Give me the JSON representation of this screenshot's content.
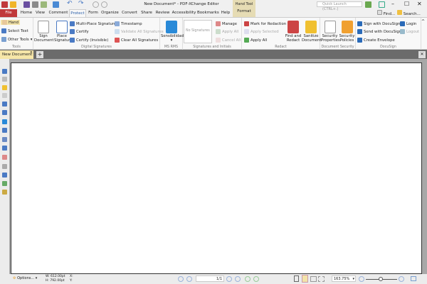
{
  "window": {
    "title": "New Document* - PDF-XChange Editor",
    "quick_launch_placeholder": "Quick Launch (CTRL+.)",
    "find": "Find...",
    "search": "Search..."
  },
  "context_tab": {
    "label": "Hand Tool",
    "sub": "Format"
  },
  "tabs": [
    "File",
    "Home",
    "View",
    "Comment",
    "Protect",
    "Form",
    "Organize",
    "Convert",
    "Share",
    "Review",
    "Accessibility",
    "Bookmarks",
    "Help"
  ],
  "active_tab": "Protect",
  "ribbon": {
    "tools": {
      "label": "Tools",
      "items": [
        "Hand",
        "Select Text",
        "Other Tools"
      ]
    },
    "digital_signatures": {
      "label": "Digital Signatures",
      "big": [
        "Sign Document",
        "Place Signature"
      ],
      "items": [
        "Multi-Place Signature",
        "Certify",
        "Certify (Invisible)",
        "Timestamp",
        "Validate All Signatures",
        "Clear All Signatures"
      ]
    },
    "ms_rms": {
      "label": "MS RMS",
      "big": "Sensibilidad"
    },
    "signatures_initials": {
      "label": "Signatures and Initials",
      "dropdown": "No Signatures",
      "items": [
        "Manage",
        "Apply All",
        "Cancel All"
      ]
    },
    "redact": {
      "label": "Redact",
      "items": [
        "Mark for Redaction",
        "Apply Selected",
        "Apply All"
      ],
      "big": [
        "Find and Redact",
        "Sanitize Document"
      ]
    },
    "document_security": {
      "label": "Document Security",
      "big": [
        "Security Properties",
        "Security Policies"
      ]
    },
    "docusign": {
      "label": "DocuSign",
      "items": [
        "Sign with DocuSign",
        "Send with DocuSign",
        "Create Envelope",
        "Login",
        "Logout"
      ]
    }
  },
  "document_tab": "New Document *",
  "status": {
    "options": "Options...",
    "width": "W: 612.00pt",
    "height": "H: 792.00pt",
    "x": "X:",
    "y": "Y:",
    "page": "1/1",
    "zoom": "163.75%"
  },
  "colors": {
    "file_tab": "#c0393b",
    "accent": "#2a5ea8",
    "context": "#e6dcb4",
    "doc_tab": "#f6e6a8"
  }
}
